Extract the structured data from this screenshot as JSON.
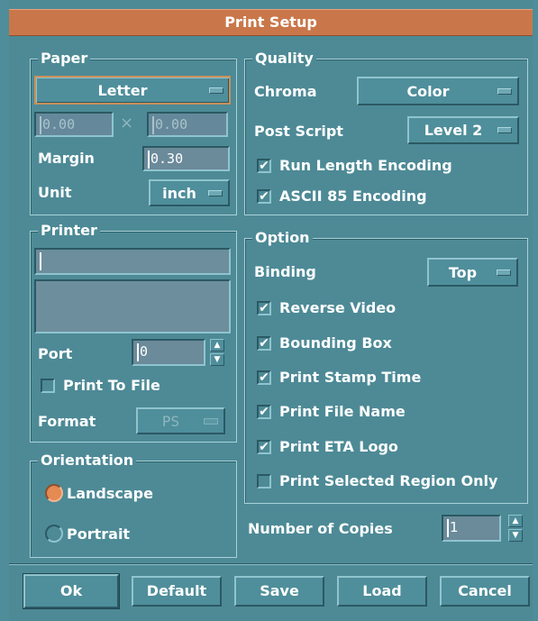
{
  "window": {
    "title": "Print Setup"
  },
  "paper": {
    "legend": "Paper",
    "size": "Letter",
    "width": "0.00",
    "height": "0.00",
    "times_symbol": "×",
    "margin_label": "Margin",
    "margin_value": "0.30",
    "unit_label": "Unit",
    "unit_value": "inch"
  },
  "quality": {
    "legend": "Quality",
    "chroma_label": "Chroma",
    "chroma_value": "Color",
    "postscript_label": "Post Script",
    "postscript_value": "Level 2",
    "rle_label": "Run Length Encoding",
    "rle_checked": true,
    "ascii85_label": "ASCII 85 Encoding",
    "ascii85_checked": true
  },
  "printer": {
    "legend": "Printer",
    "name": "",
    "port_label": "Port",
    "port_value": "0",
    "print_to_file_label": "Print To File",
    "print_to_file_checked": false,
    "format_label": "Format",
    "format_value": "PS"
  },
  "option": {
    "legend": "Option",
    "binding_label": "Binding",
    "binding_value": "Top",
    "items": [
      {
        "label": "Reverse Video",
        "checked": true
      },
      {
        "label": "Bounding Box",
        "checked": true
      },
      {
        "label": "Print Stamp Time",
        "checked": true
      },
      {
        "label": "Print File Name",
        "checked": true
      },
      {
        "label": "Print ETA Logo",
        "checked": true
      },
      {
        "label": "Print Selected Region Only",
        "checked": false
      }
    ]
  },
  "orientation": {
    "legend": "Orientation",
    "landscape_label": "Landscape",
    "portrait_label": "Portrait",
    "selected": "Landscape"
  },
  "copies": {
    "label": "Number of Copies",
    "value": "1"
  },
  "buttons": {
    "ok": "Ok",
    "default": "Default",
    "save": "Save",
    "load": "Load",
    "cancel": "Cancel"
  },
  "icons": {
    "check": "✔",
    "spin_up": "▲",
    "spin_down": "▼"
  },
  "colors": {
    "title_bar": "#c9774a",
    "background": "#4d8a96",
    "radio_selected": "#e48a52"
  }
}
